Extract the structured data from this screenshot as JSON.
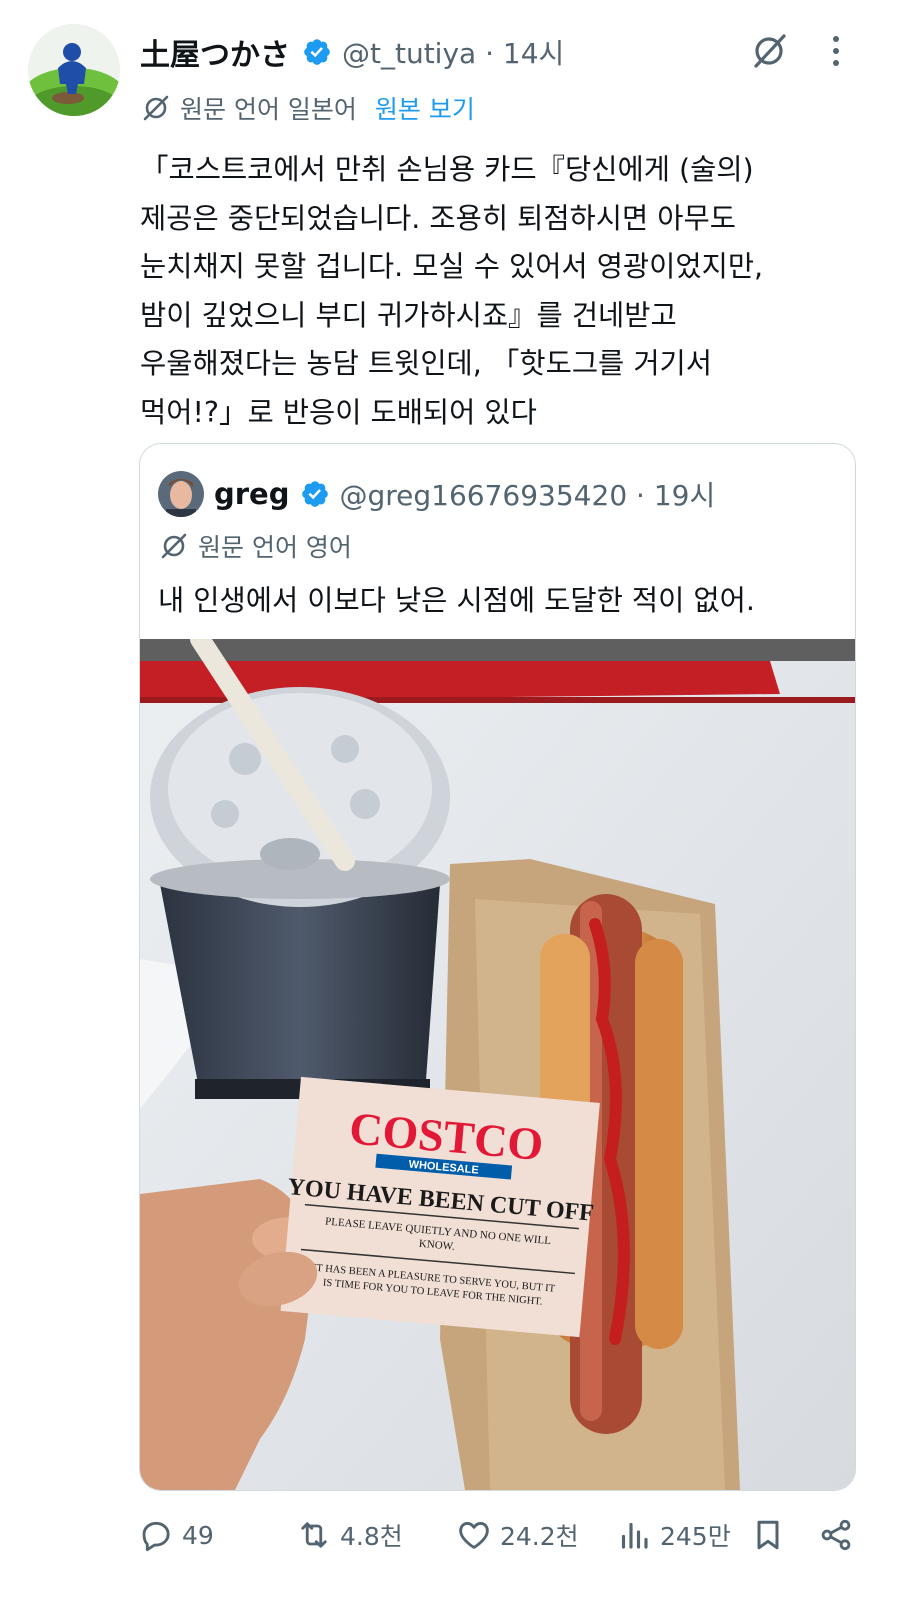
{
  "tweet": {
    "author_name": "土屋つかさ",
    "author_meta": "@t_tutiya · 14시",
    "translation_label": "원문 언어 일본어",
    "view_original": "원본 보기",
    "text_lines": [
      "「코스트코에서 만취 손님용 카드『당신에게 (술의)",
      "제공은 중단되었습니다. 조용히 퇴점하시면 아무도",
      "눈치채지 못할 겁니다. 모실 수 있어서 영광이었지만,",
      "밤이 깊었으니 부디 귀가하시죠』를 건네받고",
      "우울해졌다는 농담 트윗인데, 「핫도그를 거기서",
      "먹어!?」로 반응이 도배되어 있다"
    ]
  },
  "quote": {
    "author_name": "greg",
    "author_meta": "@greg16676935420 · 19시",
    "translation_label": "원문 언어 영어",
    "text": "내 인생에서 이보다 낮은 시점에 도달한 적이 없어."
  },
  "card": {
    "brand": "COSTCO",
    "brand_sub": "WHOLESALE",
    "headline": "YOU HAVE BEEN CUT OFF",
    "line1a": "PLEASE LEAVE QUIETLY AND NO ONE WILL",
    "line1b": "KNOW.",
    "line2a": "IT HAS BEEN A PLEASURE TO SERVE YOU, BUT IT",
    "line2b": "IS TIME FOR YOU TO LEAVE FOR THE NIGHT."
  },
  "actions": {
    "replies": "49",
    "reposts": "4.8천",
    "likes": "24.2천",
    "views": "245만"
  },
  "icons": {
    "verified": "verified-badge-icon",
    "translate": "translate-slash-icon",
    "grok": "grok-icon",
    "more": "more-vertical-icon",
    "reply": "reply-icon",
    "repost": "repost-icon",
    "like": "heart-icon",
    "views": "views-chart-icon",
    "bookmark": "bookmark-icon",
    "share": "share-icon"
  },
  "colors": {
    "accent": "#1d9bf0",
    "secondary_text": "#536471",
    "text": "#0f1419",
    "border": "#cfd9de",
    "costco_red": "#e31837",
    "costco_blue": "#005daa"
  }
}
